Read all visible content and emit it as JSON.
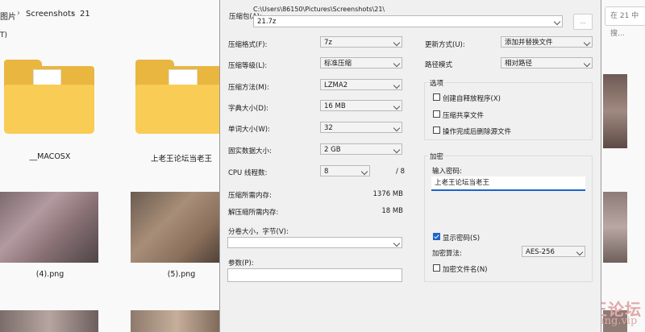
{
  "explorer": {
    "breadcrumb": [
      "图片",
      "Screenshots",
      "21"
    ],
    "search_placeholder": "在 21 中搜…",
    "toolbar_fragment": "T)",
    "items": [
      {
        "name": "__MACOSX",
        "kind": "folder"
      },
      {
        "name": "上老王论坛当老王",
        "kind": "folder"
      },
      {
        "name": "(4).png",
        "kind": "image"
      },
      {
        "name": "(5).png",
        "kind": "image"
      }
    ],
    "watermark": {
      "line1": "老王论坛",
      "line2": "laowang.vip"
    }
  },
  "dialog": {
    "archive": {
      "label": "压缩包(A):",
      "path": "C:\\Users\\86150\\Pictures\\Screenshots\\21\\",
      "name": "21.7z",
      "browse_label": "..."
    },
    "left": {
      "format": {
        "label": "压缩格式(F):",
        "value": "7z"
      },
      "level": {
        "label": "压缩等级(L):",
        "value": "标准压缩"
      },
      "method": {
        "label": "压缩方法(M):",
        "value": "LZMA2"
      },
      "dict": {
        "label": "字典大小(D):",
        "value": "16 MB"
      },
      "word": {
        "label": "单词大小(W):",
        "value": "32"
      },
      "solid": {
        "label": "固实数据大小:",
        "value": "2 GB"
      },
      "threads": {
        "label": "CPU 线程数:",
        "value": "8",
        "max": "/ 8"
      },
      "mem_compress": {
        "label": "压缩所需内存:",
        "value": "1376 MB"
      },
      "mem_decompress": {
        "label": "解压缩所需内存:",
        "value": "18 MB"
      },
      "split": {
        "label": "分卷大小，字节(V):",
        "value": ""
      },
      "params": {
        "label": "参数(P):",
        "value": ""
      }
    },
    "right": {
      "update": {
        "label": "更新方式(U):",
        "value": "添加并替换文件"
      },
      "pathmode": {
        "label": "路径模式",
        "value": "相对路径"
      },
      "options": {
        "title": "选项",
        "sfx": {
          "label": "创建自释放程序(X)",
          "checked": false
        },
        "shared": {
          "label": "压缩共享文件",
          "checked": false
        },
        "delete": {
          "label": "操作完成后删除源文件",
          "checked": false
        }
      },
      "encryption": {
        "title": "加密",
        "password_label": "输入密码:",
        "password_value": "上老王论坛当老王",
        "show_password": {
          "label": "显示密码(S)",
          "checked": true
        },
        "method_label": "加密算法:",
        "method_value": "AES-256",
        "encrypt_names": {
          "label": "加密文件名(N)",
          "checked": false
        }
      }
    }
  }
}
